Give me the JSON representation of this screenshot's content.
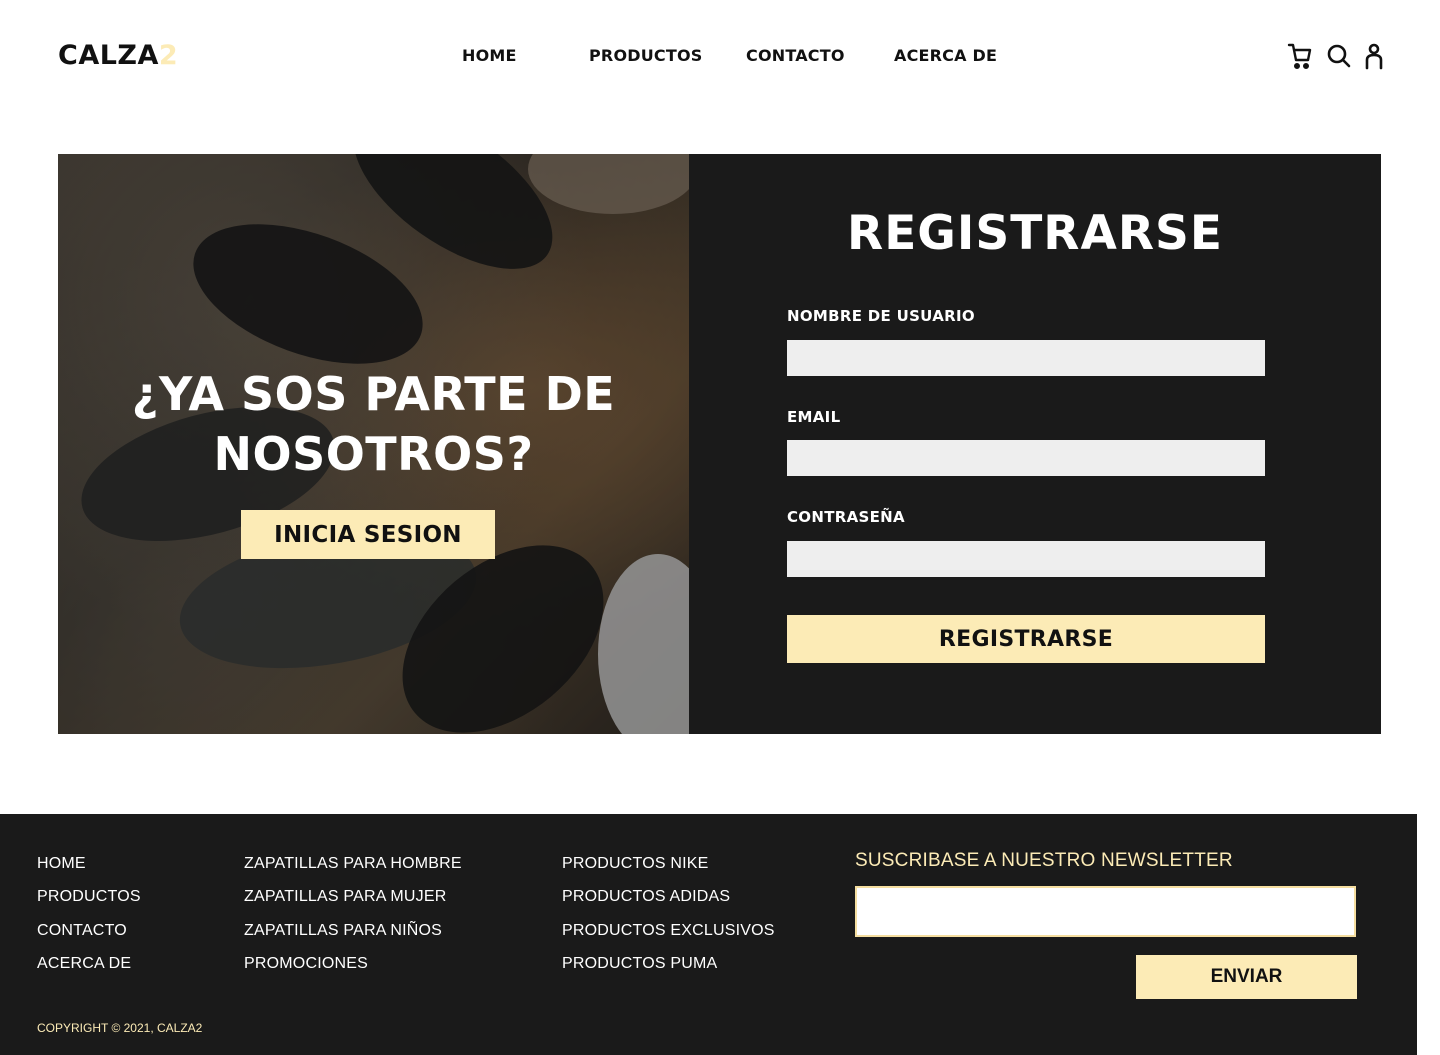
{
  "header": {
    "logo_main": "CALZA",
    "logo_accent": "2",
    "nav": [
      {
        "label": "HOME"
      },
      {
        "label": "PRODUCTOS"
      },
      {
        "label": "CONTACTO"
      },
      {
        "label": "ACERCA DE"
      }
    ],
    "icons": [
      "cart-icon",
      "search-icon",
      "user-icon"
    ]
  },
  "hero": {
    "heading_line1": "¿YA SOS PARTE DE",
    "heading_line2": "NOSOTROS?",
    "login_button": "INICIA SESION",
    "form_title": "REGISTRARSE",
    "fields": [
      {
        "label": "NOMBRE DE USUARIO",
        "value": ""
      },
      {
        "label": "EMAIL",
        "value": ""
      },
      {
        "label": "CONTRASEÑA",
        "value": ""
      }
    ],
    "submit_button": "REGISTRARSE"
  },
  "footer": {
    "col1": [
      "HOME",
      "PRODUCTOS",
      "CONTACTO",
      "ACERCA DE"
    ],
    "col2": [
      "ZAPATILLAS PARA HOMBRE",
      "ZAPATILLAS PARA MUJER",
      "ZAPATILLAS PARA NIÑOS",
      "PROMOCIONES"
    ],
    "col3": [
      "PRODUCTOS NIKE",
      "PRODUCTOS ADIDAS",
      "PRODUCTOS EXCLUSIVOS",
      "PRODUCTOS PUMA"
    ],
    "newsletter_title": "SUSCRIBASE A NUESTRO NEWSLETTER",
    "newsletter_value": "",
    "send_button": "ENVIAR",
    "copyright": "COPYRIGHT © 2021, CALZA2"
  },
  "colors": {
    "accent": "#fcebb6",
    "dark": "#1a1a1a",
    "input_bg": "#eeeeee"
  }
}
